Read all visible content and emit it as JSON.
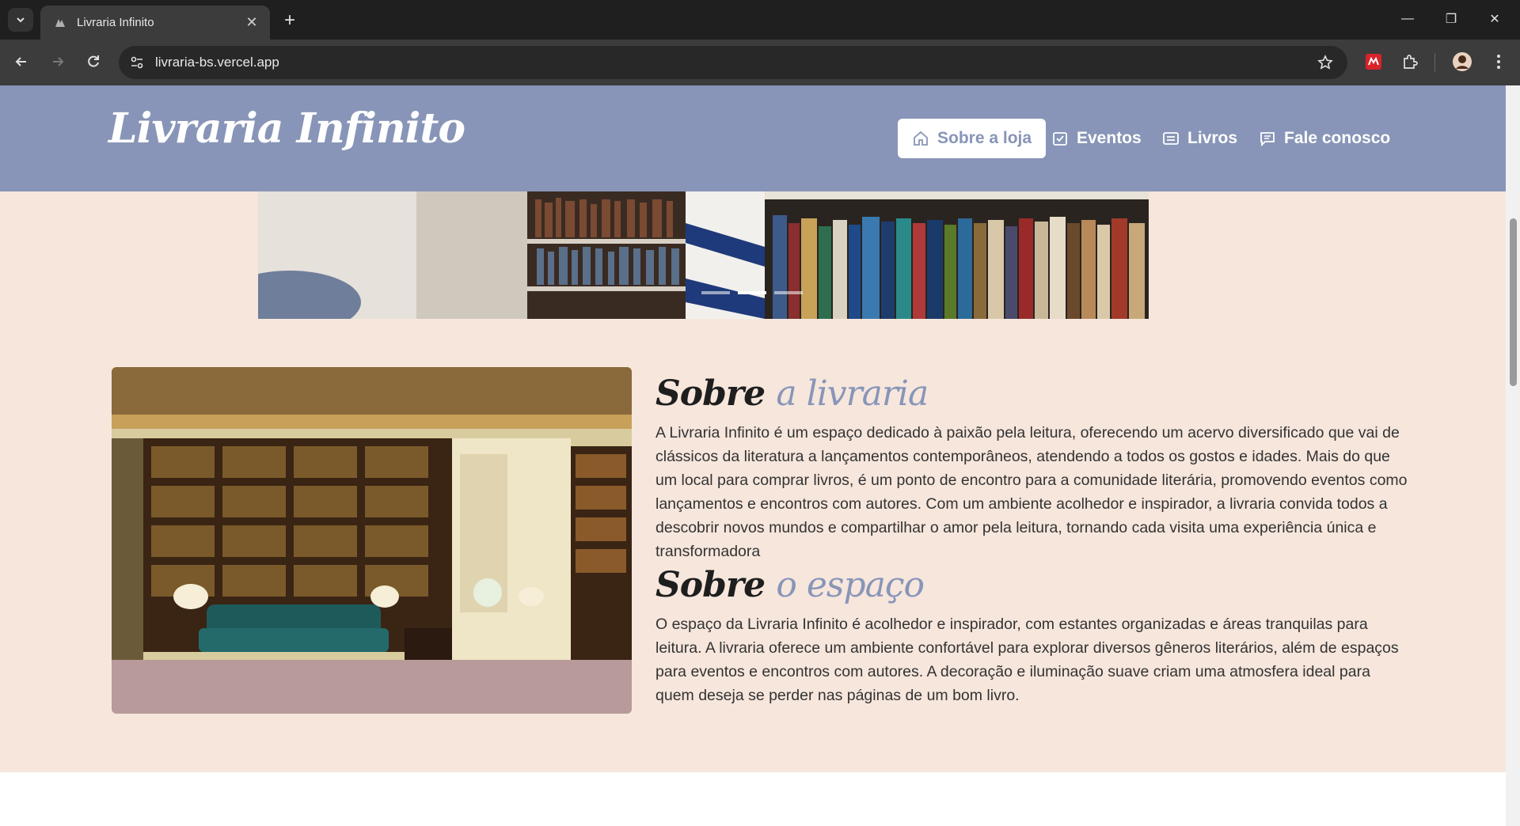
{
  "browser": {
    "tab_title": "Livraria Infinito",
    "url": "livraria-bs.vercel.app",
    "win_controls": [
      "—",
      "❐",
      "✕"
    ]
  },
  "header": {
    "logo": "Livraria Infinito",
    "nav": [
      {
        "label": "Sobre a loja",
        "icon": "home-icon",
        "active": true
      },
      {
        "label": "Eventos",
        "icon": "calendar-check-icon",
        "active": false
      },
      {
        "label": "Livros",
        "icon": "book-list-icon",
        "active": false
      },
      {
        "label": "Fale conosco",
        "icon": "chat-icon",
        "active": false
      }
    ]
  },
  "carousel": {
    "indicator_count": 3,
    "active_index": 1
  },
  "about": {
    "section1": {
      "title_main": "Sobre",
      "title_accent": "a livraria",
      "text": "A Livraria Infinito é um espaço dedicado à paixão pela leitura, oferecendo um acervo diversificado que vai de clássicos da literatura a lançamentos contemporâneos, atendendo a todos os gostos e idades. Mais do que um local para comprar livros, é um ponto de encontro para a comunidade literária, promovendo eventos como lançamentos e encontros com autores. Com um ambiente acolhedor e inspirador, a livraria convida todos a descobrir novos mundos e compartilhar o amor pela leitura, tornando cada visita uma experiência única e transformadora"
    },
    "section2": {
      "title_main": "Sobre",
      "title_accent": "o espaço",
      "text": "O espaço da Livraria Infinito é acolhedor e inspirador, com estantes organizadas e áreas tranquilas para leitura. A livraria oferece um ambiente confortável para explorar diversos gêneros literários, além de espaços para eventos e encontros com autores. A decoração e iluminação suave criam uma atmosfera ideal para quem deseja se perder nas páginas de um bom livro."
    }
  },
  "colors": {
    "header_bg": "#8895b8",
    "section_bg": "#f6e6dc",
    "accent": "#8895b8"
  }
}
